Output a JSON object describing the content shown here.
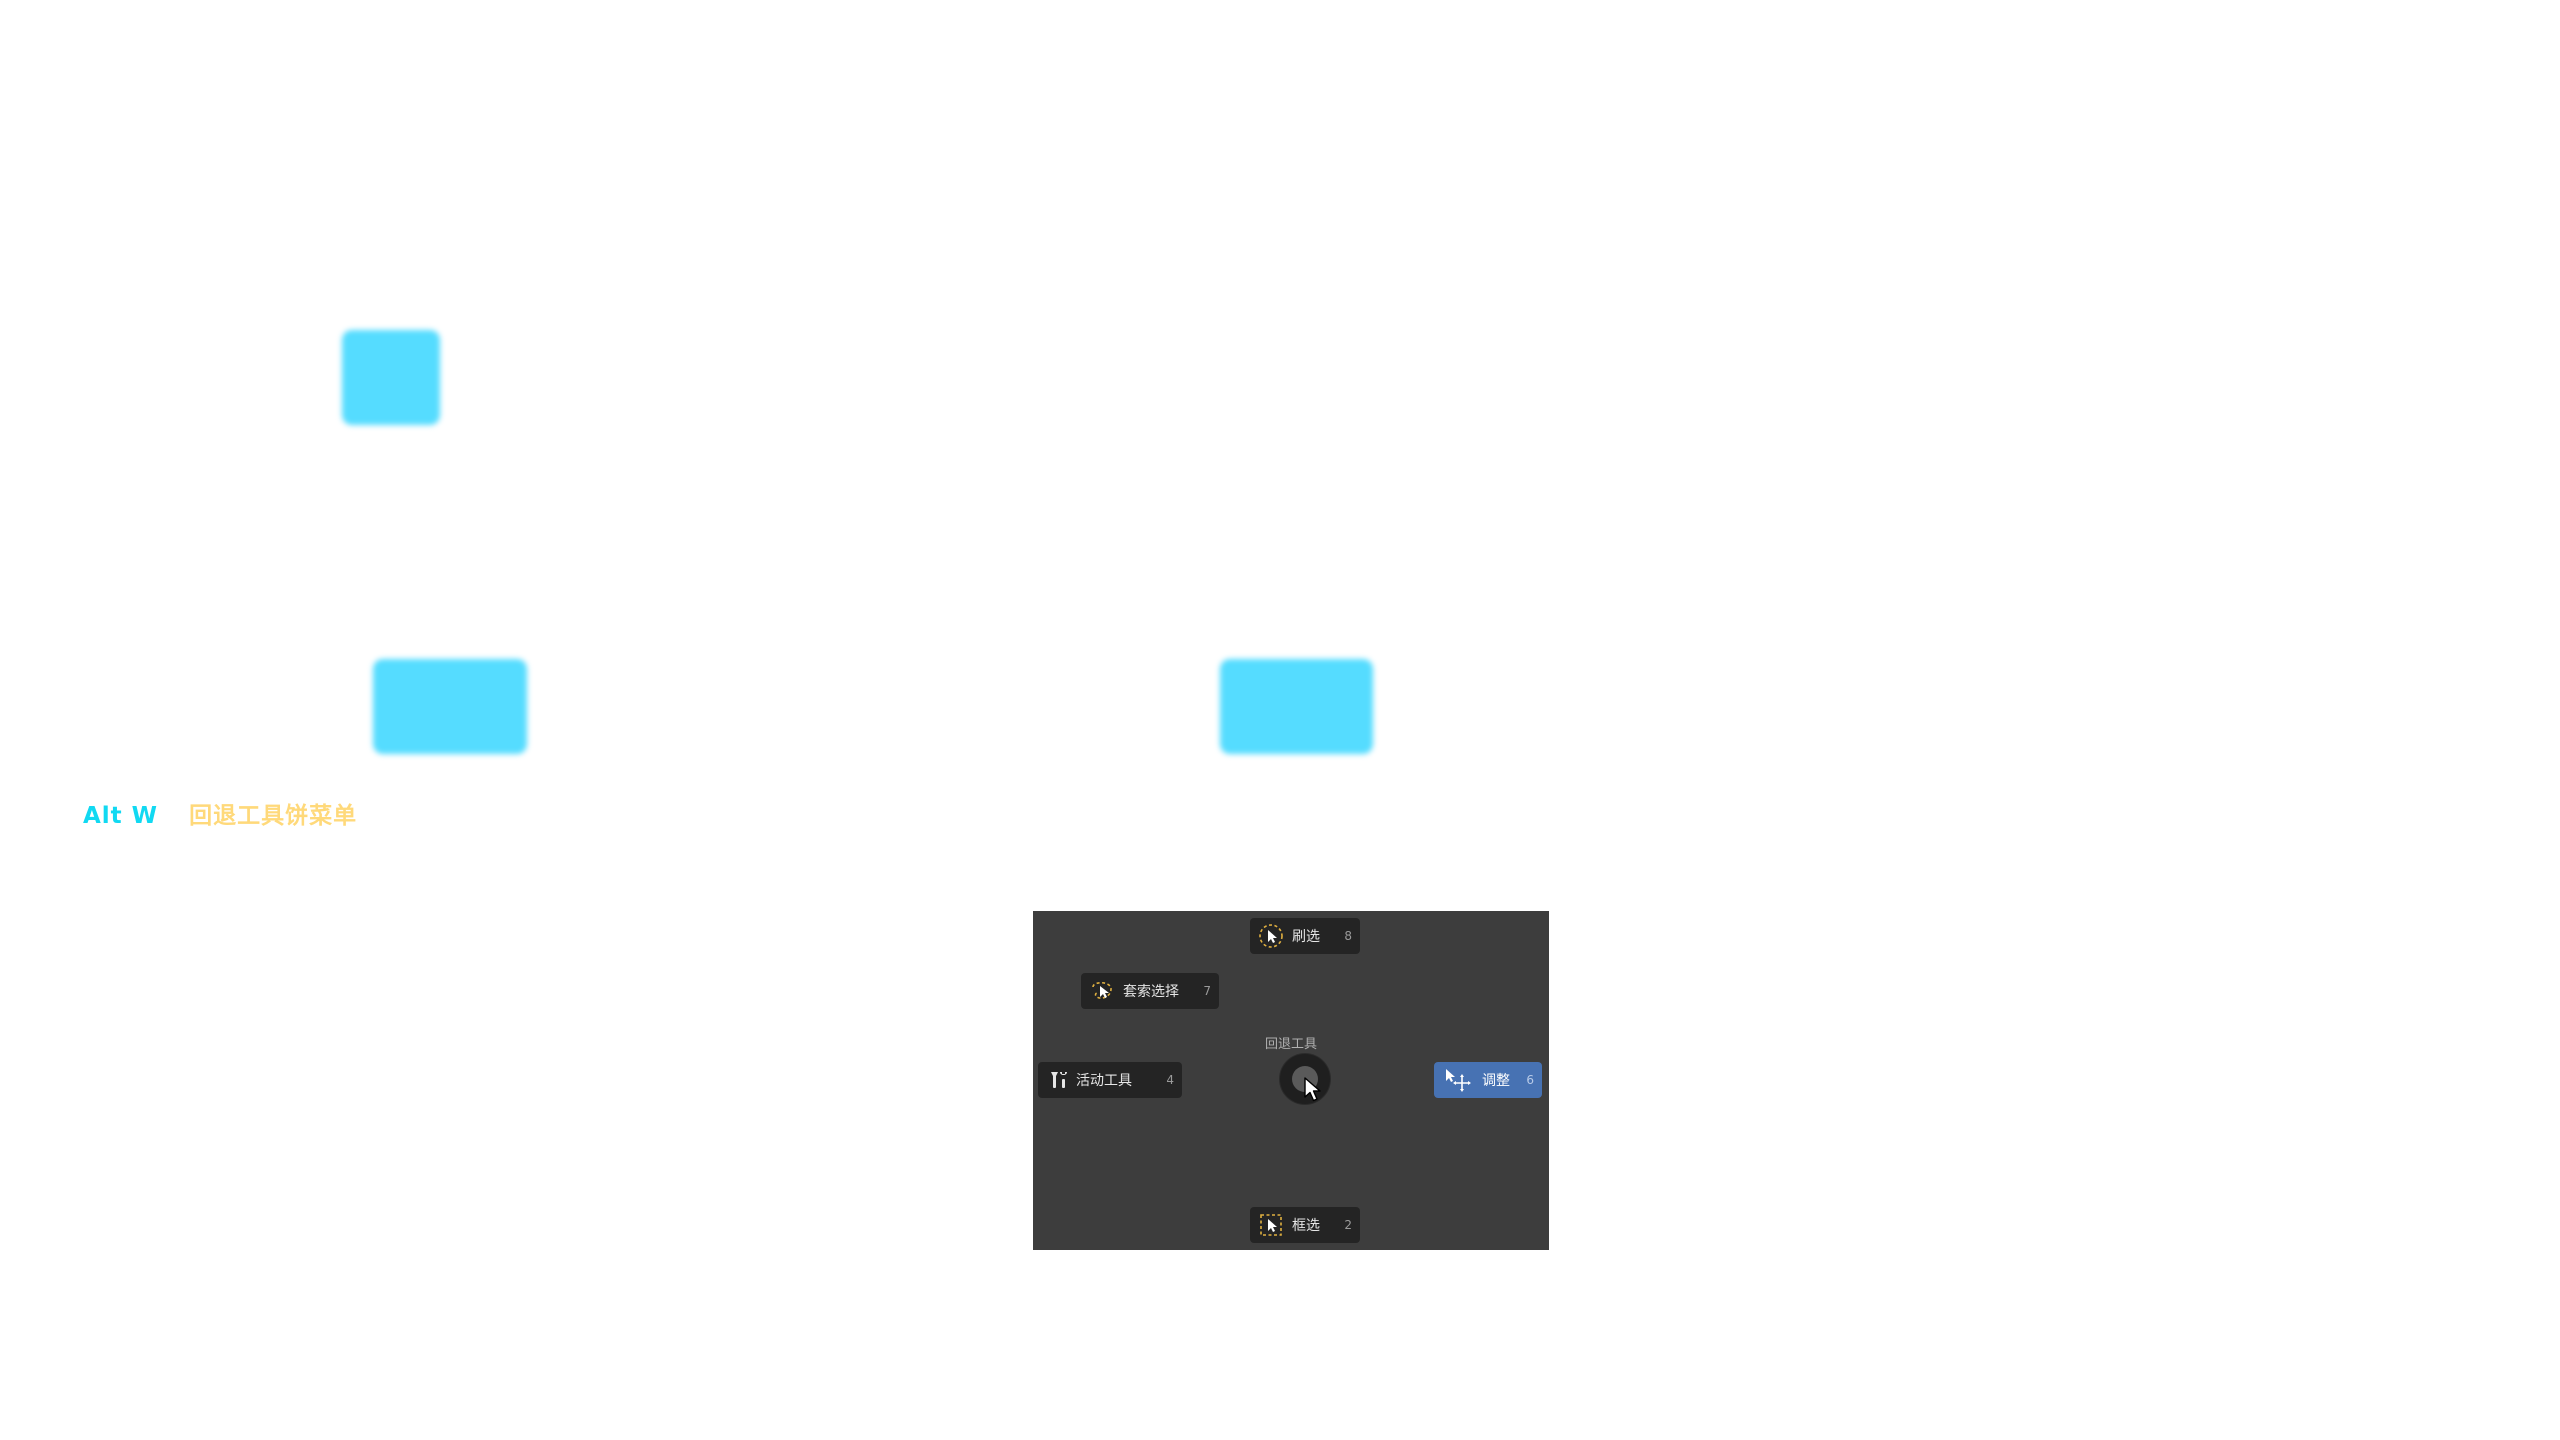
{
  "caption": {
    "shortcut": "Alt W",
    "description": "回退工具饼菜单"
  },
  "pie_menu": {
    "title": "回退工具",
    "items": [
      {
        "label": "刷选",
        "key": "8",
        "icon": "brush-select-icon",
        "active": false
      },
      {
        "label": "套索选择",
        "key": "7",
        "icon": "lasso-select-icon",
        "active": false
      },
      {
        "label": "活动工具",
        "key": "4",
        "icon": "active-tool-icon",
        "active": false
      },
      {
        "label": "调整",
        "key": "6",
        "icon": "tweak-icon",
        "active": true
      },
      {
        "label": "框选",
        "key": "2",
        "icon": "box-select-icon",
        "active": false
      }
    ]
  },
  "colors": {
    "shortcut": "#11d9f2",
    "description": "#ffd97a",
    "blur_boxes": "#55dcff",
    "panel_bg": "#3d3d3d",
    "item_bg": "#242424",
    "active_item_bg": "#4772b3",
    "icon_accent": "#e0b040"
  }
}
